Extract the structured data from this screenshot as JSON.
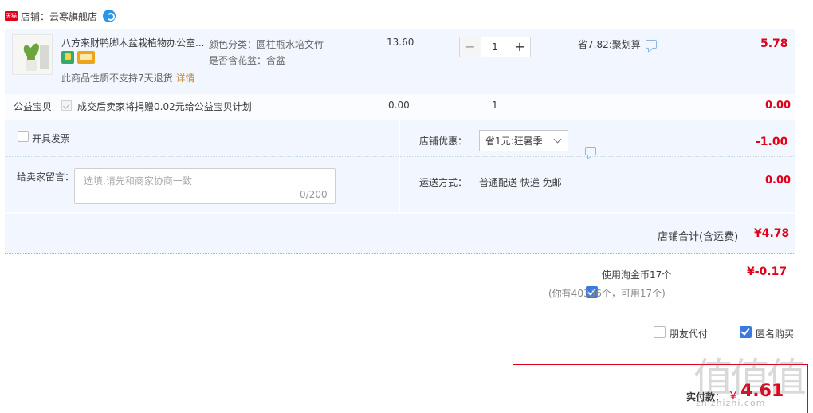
{
  "shop": {
    "label": "店铺：云寒旗舰店",
    "logo_text": "天猫"
  },
  "item": {
    "title": "八方来财鸭脚木盆栽植物办公室...",
    "sku_color": "颜色分类：圆柱瓶水培文竹",
    "sku_pot": "是否含花盆：含盆",
    "no_return": "此商品性质不支持7天退货",
    "detail_link": "详情",
    "unit_price": "13.60",
    "quantity": "1",
    "promo": "省7.82:聚划算",
    "subtotal": "5.78"
  },
  "charity": {
    "label": "公益宝贝",
    "text": "成交后卖家将捐赠0.02元给公益宝贝计划",
    "price": "0.00",
    "qty": "1",
    "subtotal": "0.00"
  },
  "invoice": {
    "label": "开具发票"
  },
  "note": {
    "label": "给卖家留言：",
    "placeholder": "选填,请先和商家协商一致",
    "count": "0/200"
  },
  "discount": {
    "label": "店铺优惠：",
    "selected": "省1元:狂暑季",
    "amount": "-1.00"
  },
  "shipping": {
    "label": "运送方式：",
    "value": "普通配送 快递 免邮",
    "amount": "0.00"
  },
  "total": {
    "label": "店铺合计(含运费)",
    "amount": "¥4.78"
  },
  "coins": {
    "label": "使用淘金币17个",
    "amount": "¥-0.17",
    "hint": "(你有40336个，可用17个)"
  },
  "options": {
    "friend_pay": "朋友代付",
    "anonymous": "匿名购买"
  },
  "pay": {
    "label": "实付款：",
    "currency": "￥",
    "amount": "4.61"
  },
  "watermark": {
    "text": "值值值",
    "url": "zhizhizhi.com"
  },
  "colors": {
    "accent_red": "#e0001b",
    "check_blue": "#3a7ae0",
    "row_bg": "#f2f7ff"
  }
}
